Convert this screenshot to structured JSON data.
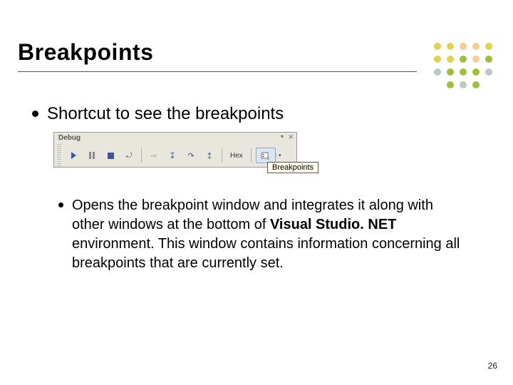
{
  "title": "Breakpoints",
  "bullets": {
    "level1": "Shortcut to see the breakpoints",
    "level2": "Opens the breakpoint window and integrates it along with other windows at the bottom of ",
    "level2_bold": "Visual Studio. NET",
    "level2_tail": " environment. This window contains information concerning all breakpoints that are currently set."
  },
  "toolbar": {
    "title": "Debug",
    "hex_label": "Hex",
    "tooltip": "Breakpoints",
    "close_glyph": "✕",
    "menu_glyph": "▾"
  },
  "page_number": "26"
}
